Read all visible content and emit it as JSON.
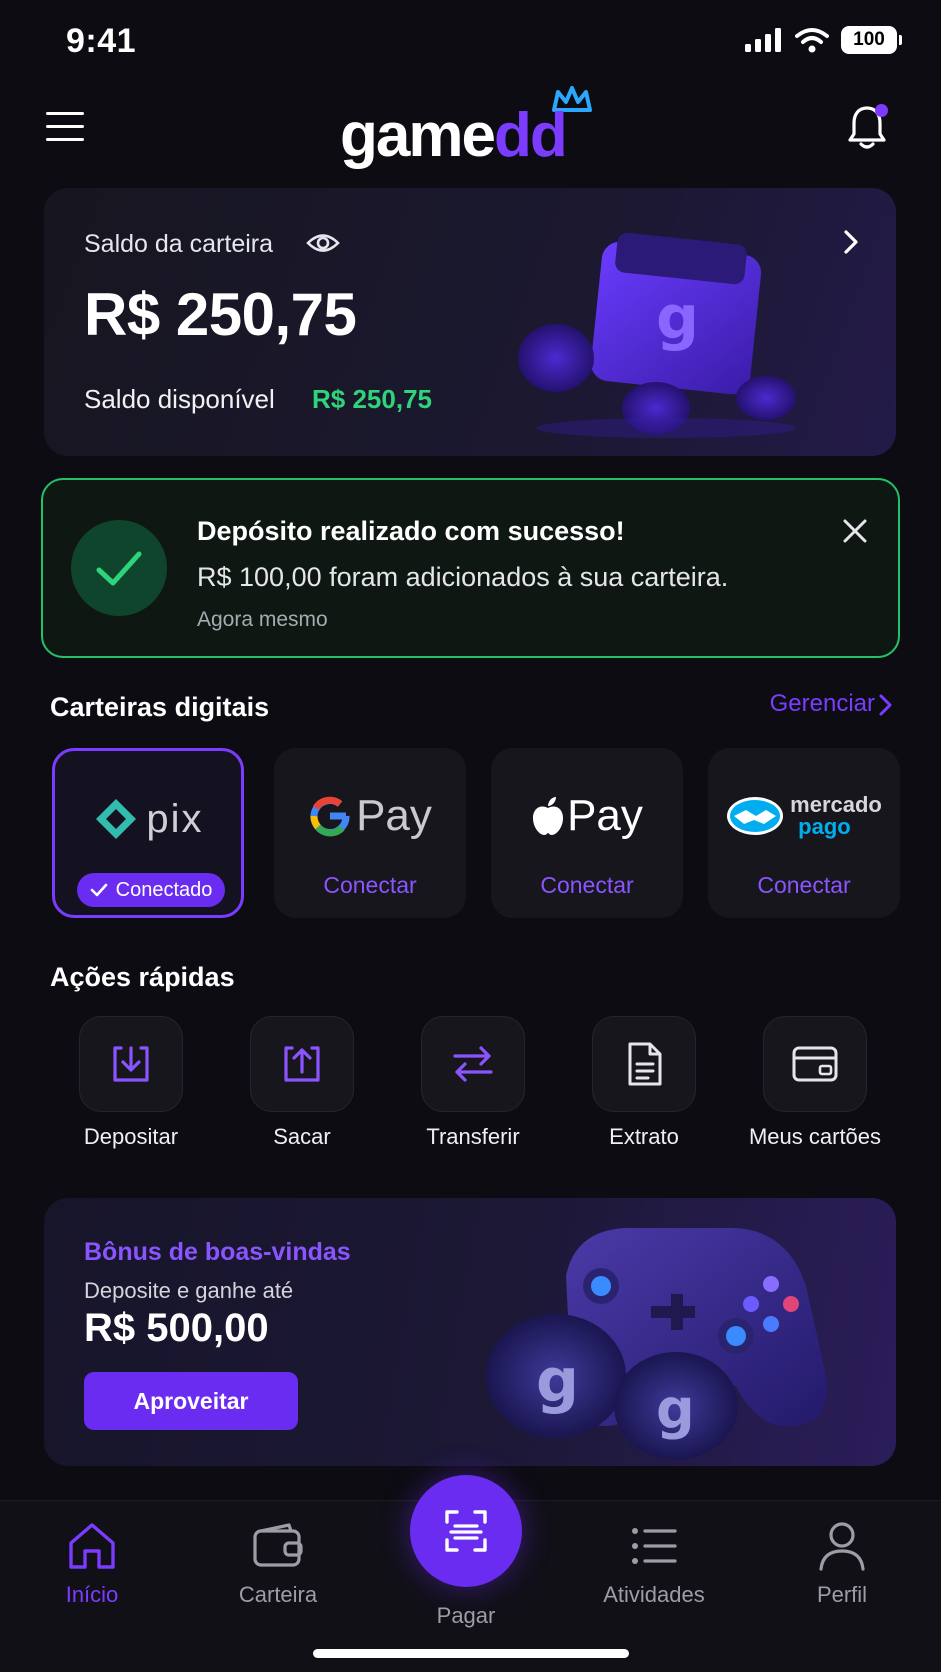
{
  "status_bar": {
    "time": "9:41",
    "battery": "100"
  },
  "header": {
    "logo_main": "game",
    "logo_accent": "dd"
  },
  "wallet": {
    "label": "Saldo da carteira",
    "amount": "R$ 250,75",
    "available_label": "Saldo disponível",
    "available_value": "R$ 250,75"
  },
  "toast": {
    "title": "Depósito realizado com sucesso!",
    "message": "R$ 100,00 foram adicionados à sua carteira.",
    "time": "Agora mesmo"
  },
  "digital_wallets": {
    "title": "Carteiras digitais",
    "manage_label": "Gerenciar",
    "items": [
      {
        "name": "pix",
        "logo_text": "pix",
        "status": "Conectado",
        "connected": true
      },
      {
        "name": "gpay",
        "logo_text": "Pay",
        "status": "Conectar",
        "connected": false
      },
      {
        "name": "applepay",
        "logo_text": "Pay",
        "status": "Conectar",
        "connected": false
      },
      {
        "name": "mercadopago",
        "logo_text_1": "mercado",
        "logo_text_2": "pago",
        "status": "Conectar",
        "connected": false
      }
    ]
  },
  "quick_actions": {
    "title": "Ações rápidas",
    "items": [
      {
        "label": "Depositar",
        "icon": "deposit-icon"
      },
      {
        "label": "Sacar",
        "icon": "withdraw-icon"
      },
      {
        "label": "Transferir",
        "icon": "transfer-icon"
      },
      {
        "label": "Extrato",
        "icon": "statement-icon"
      },
      {
        "label": "Meus cartões",
        "icon": "card-icon"
      }
    ]
  },
  "promo": {
    "title": "Bônus de boas-vindas",
    "subtitle": "Deposite e ganhe até",
    "amount": "R$ 500,00",
    "button": "Aproveitar"
  },
  "bottom_nav": {
    "items": [
      {
        "label": "Início",
        "icon": "home-icon",
        "active": true
      },
      {
        "label": "Carteira",
        "icon": "wallet-icon",
        "active": false
      },
      {
        "label": "Pagar",
        "icon": "scan-icon",
        "active": false
      },
      {
        "label": "Atividades",
        "icon": "list-icon",
        "active": false
      },
      {
        "label": "Perfil",
        "icon": "user-icon",
        "active": false
      }
    ]
  },
  "colors": {
    "accent": "#7b3cff",
    "success": "#22c26b",
    "background": "#0d0c12"
  }
}
